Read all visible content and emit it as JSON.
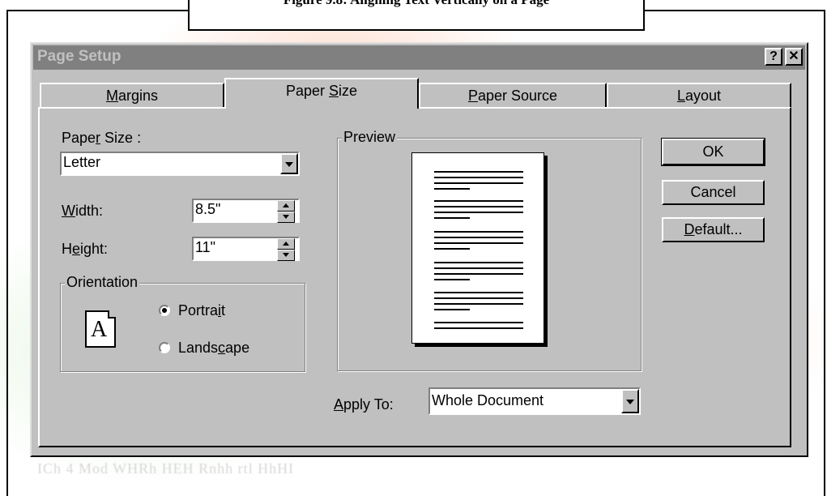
{
  "figure_caption": "Figure 9.8: Aligning Text Vertically on a Page",
  "background_text": "ICh 4 Mod WHRh HEH Rnhh rtl HhHI",
  "dialog": {
    "title": "Page Setup",
    "help_glyph": "?",
    "close_glyph": "✕"
  },
  "tabs": [
    {
      "pre": "",
      "key": "M",
      "post": "argins"
    },
    {
      "pre": "Paper ",
      "key": "S",
      "post": "ize"
    },
    {
      "pre": "",
      "key": "P",
      "post": "aper Source"
    },
    {
      "pre": "",
      "key": "L",
      "post": "ayout"
    }
  ],
  "paper_size": {
    "label_pre": "Pape",
    "label_key": "r",
    "label_post": " Size :",
    "value": "Letter"
  },
  "width": {
    "label_pre": "",
    "label_key": "W",
    "label_post": "idth:",
    "value": "8.5\""
  },
  "height": {
    "label_pre": "H",
    "label_key": "e",
    "label_post": "ight:",
    "value": "11\""
  },
  "orientation": {
    "group_label": "Orientation",
    "icon_glyph": "A",
    "portrait": {
      "pre": "Portra",
      "key": "i",
      "post": "t",
      "selected": true
    },
    "landscape": {
      "pre": "Lands",
      "key": "c",
      "post": "ape",
      "selected": false
    }
  },
  "preview": {
    "group_label": "Preview"
  },
  "apply_to": {
    "label_pre": "",
    "label_key": "A",
    "label_post": "pply To:",
    "value": "Whole Document"
  },
  "buttons": {
    "ok": "OK",
    "cancel": "Cancel",
    "default_key": "D",
    "default_post": "efault..."
  },
  "colors": {
    "dialog_face": "#c0c0c0",
    "titlebar_inactive": "#808080",
    "field_bg": "#ffffff"
  }
}
